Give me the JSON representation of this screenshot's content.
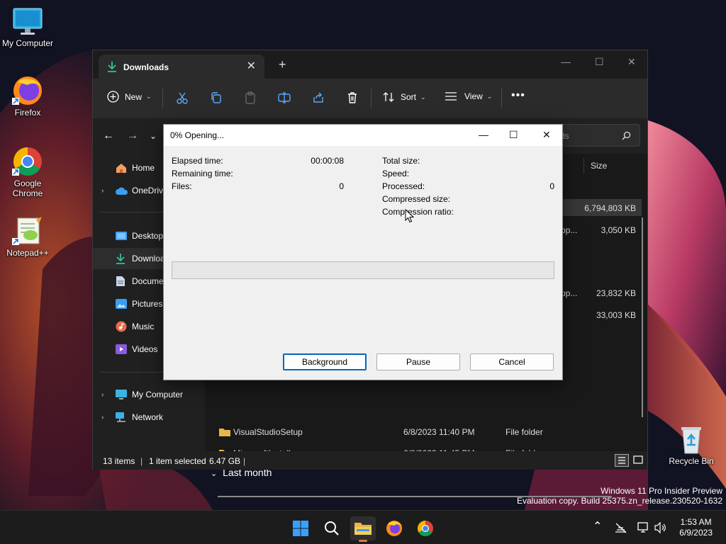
{
  "desktop": {
    "icons": [
      {
        "label": "My Computer"
      },
      {
        "label": "Firefox"
      },
      {
        "label": "Google Chrome"
      },
      {
        "label": "Notepad++"
      },
      {
        "label": "Recycle Bin"
      }
    ]
  },
  "explorer": {
    "tab_title": "Downloads",
    "toolbar": {
      "new_label": "New",
      "sort_label": "Sort",
      "view_label": "View"
    },
    "search_placeholder": "ds",
    "nav": [
      {
        "label": "Home"
      },
      {
        "label": "OneDriv"
      },
      {
        "label": "Desktop"
      },
      {
        "label": "Downloa"
      },
      {
        "label": "Docume"
      },
      {
        "label": "Pictures"
      },
      {
        "label": "Music"
      },
      {
        "label": "Videos"
      },
      {
        "label": "My Computer"
      },
      {
        "label": "Network"
      }
    ],
    "columns": {
      "size": "Size"
    },
    "sizes": [
      "6,794,803 KB",
      "3,050 KB",
      "23,832 KB",
      "33,003 KB"
    ],
    "partial_text": [
      "pp...",
      "pp..."
    ],
    "rows": [
      {
        "name": "VisualStudioSetup",
        "date": "6/8/2023 11:40 PM",
        "type": "File folder"
      },
      {
        "name": "MinecraftInstaller",
        "date": "6/8/2023 11:45 PM",
        "type": "File folder"
      }
    ],
    "group_last_month": "Last month",
    "status": {
      "items": "13 items",
      "selected": "1 item selected",
      "size": "6.47 GB"
    }
  },
  "dialog": {
    "title": "0% Opening...",
    "left": [
      {
        "label": "Elapsed time:",
        "value": "00:00:08"
      },
      {
        "label": "Remaining time:",
        "value": ""
      },
      {
        "label": "Files:",
        "value": "0"
      }
    ],
    "right": [
      {
        "label": "Total size:",
        "value": ""
      },
      {
        "label": "Speed:",
        "value": ""
      },
      {
        "label": "Processed:",
        "value": "0"
      },
      {
        "label": "Compressed size:",
        "value": ""
      },
      {
        "label": "Compression ratio:",
        "value": ""
      }
    ],
    "progress": 0,
    "buttons": {
      "background": "Background",
      "pause": "Pause",
      "cancel": "Cancel"
    }
  },
  "watermark": {
    "line1": "Windows 11 Pro Insider Preview",
    "line2": "Evaluation copy. Build 25375.zn_release.230520-1632"
  },
  "clock": {
    "time": "1:53 AM",
    "date": "6/9/2023"
  },
  "colors": {
    "accent": "#0067c0",
    "progress": "#06b025",
    "folder": "#e8b64c"
  }
}
